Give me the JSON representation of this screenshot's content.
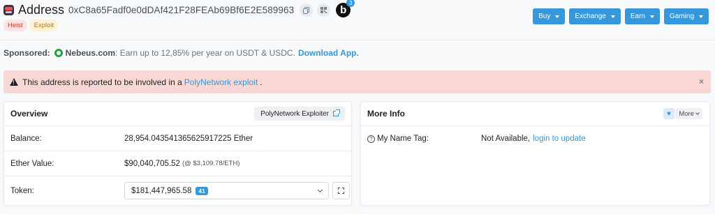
{
  "header": {
    "title": "Address",
    "address": "0xC8a65Fadf0e0dDAf421F28FEAb69Bf6E2E589963",
    "b_badge_letter": "b",
    "b_badge_count": "3"
  },
  "tags": [
    "Heist",
    "Exploit"
  ],
  "top_menu": {
    "buy": "Buy",
    "exchange": "Exchange",
    "earn": "Earn",
    "gaming": "Gaming"
  },
  "sponsored": {
    "label": "Sponsored:",
    "brand": "Nebeus.com",
    "text": ": Earn up to 12,85% per year on USDT & USDC.",
    "cta": "Download App."
  },
  "alert": {
    "prefix": "This address is reported to be involved in a",
    "link": "PolyNetwork exploit",
    "suffix": ".",
    "close": "×"
  },
  "overview": {
    "title": "Overview",
    "tag_button": "PolyNetwork Exploiter",
    "balance_label": "Balance:",
    "balance_value": "28,954.043541365625917225 Ether",
    "ether_value_label": "Ether Value:",
    "ether_value": "$90,040,705.52",
    "ether_price": "(@ $3,109.78/ETH)",
    "token_label": "Token:",
    "token_value": "$181,447,965.58",
    "token_count": "41"
  },
  "more_info": {
    "title": "More Info",
    "more_button": "More",
    "name_tag_label": "My Name Tag:",
    "name_tag_value": "Not Available,",
    "name_tag_link": "login to update"
  },
  "colors": {
    "accent": "#3498db",
    "alert_bg": "#f9d7d5",
    "heist_tag": "#fbe4e4",
    "exploit_tag": "#fcf1d5"
  }
}
